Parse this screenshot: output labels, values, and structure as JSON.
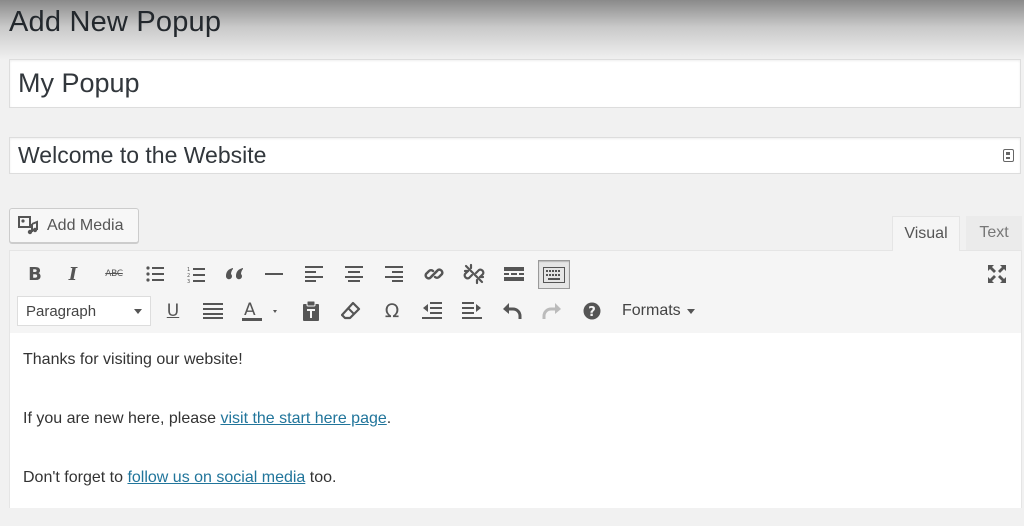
{
  "page": {
    "title": "Add New Popup"
  },
  "fields": {
    "title_value": "My Popup",
    "subtitle_value": "Welcome to the Website"
  },
  "media": {
    "add_media_label": "Add Media"
  },
  "tabs": [
    {
      "label": "Visual",
      "active": true
    },
    {
      "label": "Text",
      "active": false
    }
  ],
  "toolbar": {
    "bold": "B",
    "italic": "I",
    "strikethrough": "ABC",
    "underline": "U",
    "omega": "Ω",
    "format_select": "Paragraph",
    "formats_menu": "Formats",
    "help": "?"
  },
  "content": {
    "para1": "Thanks for visiting our website!",
    "para2_before": "If you are new here, please ",
    "para2_link": "visit the start here page",
    "para2_after": ".",
    "para3_before": "Don't forget to ",
    "para3_link": "follow us on social media",
    "para3_after": " too."
  },
  "colors": {
    "link": "#21759b",
    "icon": "#555555",
    "toolbar_bg": "#f5f5f5",
    "page_bg": "#f1f1f1"
  }
}
